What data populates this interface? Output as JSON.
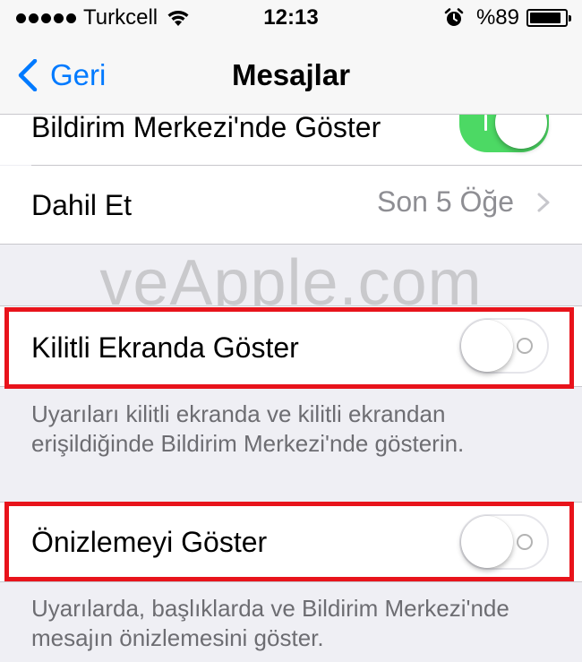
{
  "status_bar": {
    "carrier": "Turkcell",
    "time": "12:13",
    "battery_percent": "%89",
    "battery_level": 0.89,
    "signal_bars": 5,
    "icons": [
      "signal-dots",
      "wifi-icon",
      "alarm-icon",
      "battery-icon"
    ]
  },
  "nav": {
    "back_label": "Geri",
    "title": "Mesajlar"
  },
  "cells": {
    "notification_center": {
      "label": "Bildirim Merkezi'nde Göster",
      "on": true
    },
    "include": {
      "label": "Dahil Et",
      "value": "Son 5 Öğe"
    },
    "lock_screen": {
      "label": "Kilitli Ekranda Göster",
      "on": false
    },
    "preview": {
      "label": "Önizlemeyi Göster",
      "on": false
    }
  },
  "footers": {
    "lock_screen": "Uyarıları kilitli ekranda ve kilitli ekrandan erişildiğinde Bildirim Merkezi'nde gösterin.",
    "preview": "Uyarılarda, başlıklarda ve Bildirim Merkezi'nde mesajın önizlemesini göster."
  },
  "watermark": "veApple.com",
  "colors": {
    "accent": "#007aff",
    "toggle_on": "#4cd964",
    "highlight": "#e8131b",
    "background": "#efeff4"
  }
}
